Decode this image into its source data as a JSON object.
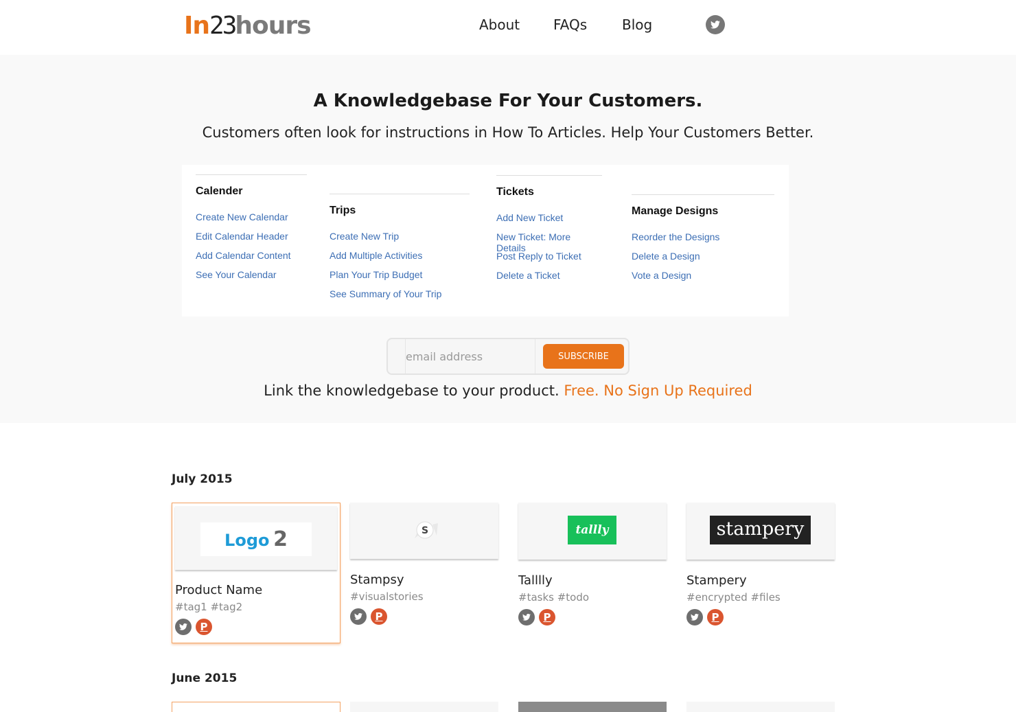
{
  "header": {
    "logo": {
      "in": "In",
      "num": "23",
      "hours": "hours"
    },
    "nav": [
      "About",
      "FAQs",
      "Blog"
    ],
    "twitter_icon": "twitter-icon"
  },
  "hero": {
    "title": "A Knowledgebase For Your Customers.",
    "subtitle": "Customers often look for instructions in How To Articles. Help Your Customers Better.",
    "kb_columns": [
      {
        "heading": "Calender",
        "links": [
          "Create New Calendar",
          "Edit Calendar Header",
          "Add Calendar Content",
          "See Your Calendar"
        ]
      },
      {
        "heading": "Trips",
        "links": [
          "Create New Trip",
          "Add Multiple Activities",
          "Plan Your Trip Budget",
          "See Summary of Your Trip"
        ]
      },
      {
        "heading": "Tickets",
        "links": [
          "Add New Ticket",
          "New Ticket: More Details",
          "Post Reply to Ticket",
          "Delete a Ticket"
        ]
      },
      {
        "heading": "Manage Designs",
        "links": [
          "Reorder the Designs",
          "Delete a Design",
          "Vote a Design"
        ]
      }
    ],
    "subscribe": {
      "placeholder": "email address",
      "button": "SUBSCRIBE"
    },
    "cta": {
      "text": "Link the knowledgebase to your product.",
      "highlight": "Free. No Sign Up Required"
    }
  },
  "listings": [
    {
      "month": "July 2015",
      "products": [
        {
          "name": "Product Name",
          "tags": "#tag1 #tag2",
          "logo_text": [
            "Logo",
            "2"
          ]
        },
        {
          "name": "Stampsy",
          "tags": "#visualstories",
          "logo_text": [
            "S"
          ]
        },
        {
          "name": "Talllly",
          "tags": "#tasks #todo",
          "logo_text": [
            "tallly"
          ]
        },
        {
          "name": "Stampery",
          "tags": "#encrypted #files",
          "logo_text": [
            "stampery"
          ]
        }
      ]
    },
    {
      "month": "June 2015"
    }
  ],
  "icons": {
    "twitter": "twitter-icon",
    "producthunt": "producthunt-icon",
    "producthunt_letter": "P"
  },
  "colors": {
    "accent": "#e8731a",
    "link": "#3c6eb4",
    "hero_bg": "#f9f9f9",
    "tallly": "#18c05a",
    "producthunt": "#da552f"
  }
}
